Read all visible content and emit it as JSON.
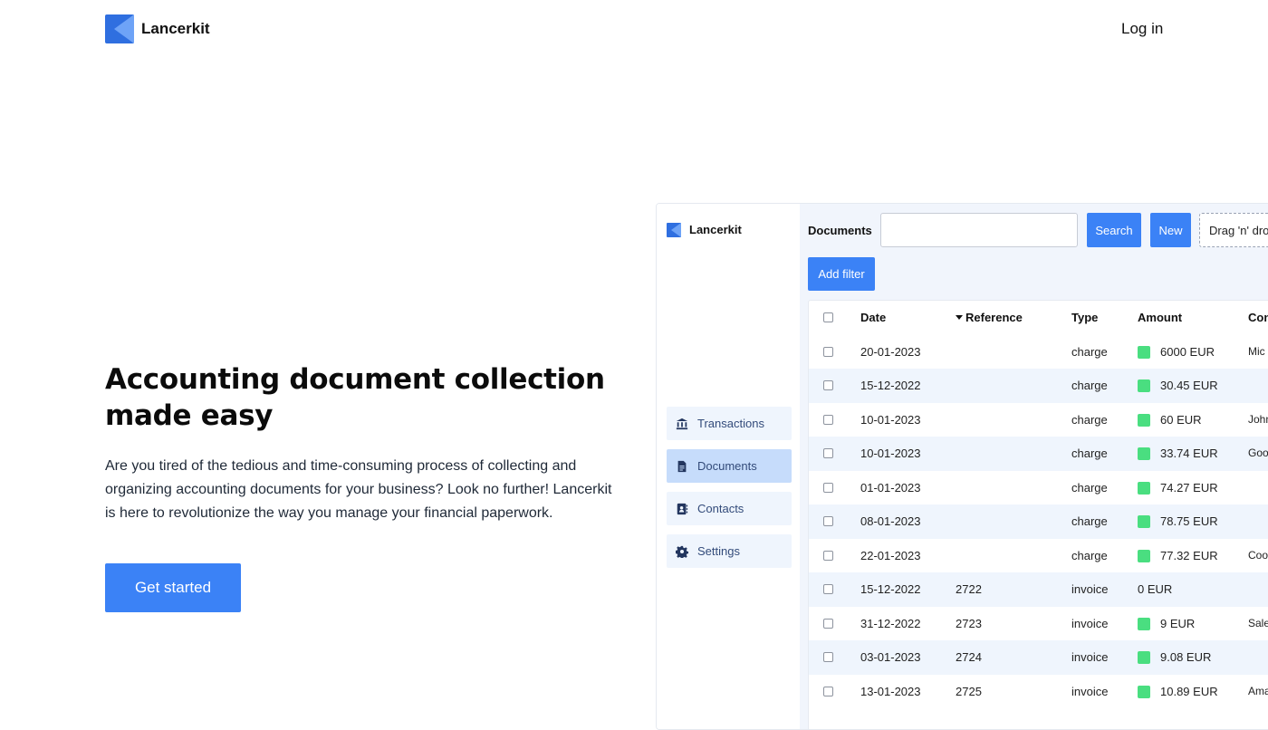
{
  "topnav": {
    "brand": "Lancerkit",
    "login": "Log in"
  },
  "hero": {
    "title": "Accounting document collection made easy",
    "description": "Are you tired of the tedious and time-consuming process of collecting and organizing accounting documents for your business? Look no further! Lancerkit is here to revolutionize the way you manage your financial paperwork.",
    "cta": "Get started"
  },
  "colors": {
    "accent": "#3b82f6",
    "logo_dark": "#2f6fe0",
    "logo_light": "#6ea3f7",
    "status_ok": "#4ade80"
  },
  "app": {
    "brand": "Lancerkit",
    "sidebar": {
      "items": [
        {
          "label": "Transactions",
          "icon": "bank-icon",
          "active": false
        },
        {
          "label": "Documents",
          "icon": "document-icon",
          "active": true
        },
        {
          "label": "Contacts",
          "icon": "contacts-icon",
          "active": false
        },
        {
          "label": "Settings",
          "icon": "gear-icon",
          "active": false
        }
      ]
    },
    "toolbar": {
      "title": "Documents",
      "search_value": "",
      "search_button": "Search",
      "new_button": "New",
      "drop_zone": "Drag 'n' drop",
      "add_filter": "Add filter"
    },
    "table": {
      "columns": {
        "date": "Date",
        "reference": "Reference",
        "type": "Type",
        "amount": "Amount",
        "contact": "Con"
      },
      "sorted_column": "reference",
      "rows": [
        {
          "date": "20-01-2023",
          "reference": "",
          "type": "charge",
          "amount": "6000 EUR",
          "status": true,
          "contact": "Mic"
        },
        {
          "date": "15-12-2022",
          "reference": "",
          "type": "charge",
          "amount": "30.45 EUR",
          "status": true,
          "contact": ""
        },
        {
          "date": "10-01-2023",
          "reference": "",
          "type": "charge",
          "amount": "60 EUR",
          "status": true,
          "contact": "John"
        },
        {
          "date": "10-01-2023",
          "reference": "",
          "type": "charge",
          "amount": "33.74 EUR",
          "status": true,
          "contact": "Goo"
        },
        {
          "date": "01-01-2023",
          "reference": "",
          "type": "charge",
          "amount": "74.27 EUR",
          "status": true,
          "contact": ""
        },
        {
          "date": "08-01-2023",
          "reference": "",
          "type": "charge",
          "amount": "78.75 EUR",
          "status": true,
          "contact": ""
        },
        {
          "date": "22-01-2023",
          "reference": "",
          "type": "charge",
          "amount": "77.32 EUR",
          "status": true,
          "contact": "Coo"
        },
        {
          "date": "15-12-2022",
          "reference": "2722",
          "type": "invoice",
          "amount": "0 EUR",
          "status": false,
          "contact": ""
        },
        {
          "date": "31-12-2022",
          "reference": "2723",
          "type": "invoice",
          "amount": "9 EUR",
          "status": true,
          "contact": "Sale"
        },
        {
          "date": "03-01-2023",
          "reference": "2724",
          "type": "invoice",
          "amount": "9.08 EUR",
          "status": true,
          "contact": ""
        },
        {
          "date": "13-01-2023",
          "reference": "2725",
          "type": "invoice",
          "amount": "10.89 EUR",
          "status": true,
          "contact": "Ama"
        }
      ]
    }
  }
}
